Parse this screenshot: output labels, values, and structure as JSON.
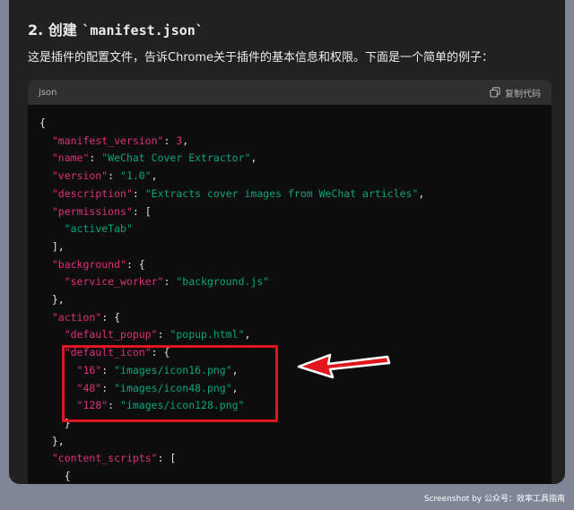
{
  "heading": {
    "prefix": "2. 创建 ",
    "code": "`manifest.json`"
  },
  "description": "这是插件的配置文件，告诉Chrome关于插件的基本信息和权限。下面是一个简单的例子：",
  "code_block": {
    "language": "json",
    "copy_label": "复制代码",
    "lines": [
      [
        [
          "p",
          "{"
        ]
      ],
      [
        [
          "p",
          "  "
        ],
        [
          "k",
          "\"manifest_version\""
        ],
        [
          "p",
          ": "
        ],
        [
          "n",
          "3"
        ],
        [
          "p",
          ","
        ]
      ],
      [
        [
          "p",
          "  "
        ],
        [
          "k",
          "\"name\""
        ],
        [
          "p",
          ": "
        ],
        [
          "s",
          "\"WeChat Cover Extractor\""
        ],
        [
          "p",
          ","
        ]
      ],
      [
        [
          "p",
          "  "
        ],
        [
          "k",
          "\"version\""
        ],
        [
          "p",
          ": "
        ],
        [
          "s",
          "\"1.0\""
        ],
        [
          "p",
          ","
        ]
      ],
      [
        [
          "p",
          "  "
        ],
        [
          "k",
          "\"description\""
        ],
        [
          "p",
          ": "
        ],
        [
          "s",
          "\"Extracts cover images from WeChat articles\""
        ],
        [
          "p",
          ","
        ]
      ],
      [
        [
          "p",
          "  "
        ],
        [
          "k",
          "\"permissions\""
        ],
        [
          "p",
          ": ["
        ]
      ],
      [
        [
          "p",
          "    "
        ],
        [
          "s",
          "\"activeTab\""
        ]
      ],
      [
        [
          "p",
          "  ],"
        ]
      ],
      [
        [
          "p",
          "  "
        ],
        [
          "k",
          "\"background\""
        ],
        [
          "p",
          ": {"
        ]
      ],
      [
        [
          "p",
          "    "
        ],
        [
          "k",
          "\"service_worker\""
        ],
        [
          "p",
          ": "
        ],
        [
          "s",
          "\"background.js\""
        ]
      ],
      [
        [
          "p",
          "  },"
        ]
      ],
      [
        [
          "p",
          "  "
        ],
        [
          "k",
          "\"action\""
        ],
        [
          "p",
          ": {"
        ]
      ],
      [
        [
          "p",
          "    "
        ],
        [
          "k",
          "\"default_popup\""
        ],
        [
          "p",
          ": "
        ],
        [
          "s",
          "\"popup.html\""
        ],
        [
          "p",
          ","
        ]
      ],
      [
        [
          "p",
          "    "
        ],
        [
          "k",
          "\"default_icon\""
        ],
        [
          "p",
          ": {"
        ]
      ],
      [
        [
          "p",
          "      "
        ],
        [
          "k",
          "\"16\""
        ],
        [
          "p",
          ": "
        ],
        [
          "s",
          "\"images/icon16.png\""
        ],
        [
          "p",
          ","
        ]
      ],
      [
        [
          "p",
          "      "
        ],
        [
          "k",
          "\"48\""
        ],
        [
          "p",
          ": "
        ],
        [
          "s",
          "\"images/icon48.png\""
        ],
        [
          "p",
          ","
        ]
      ],
      [
        [
          "p",
          "      "
        ],
        [
          "k",
          "\"128\""
        ],
        [
          "p",
          ": "
        ],
        [
          "s",
          "\"images/icon128.png\""
        ]
      ],
      [
        [
          "p",
          "    }"
        ]
      ],
      [
        [
          "p",
          "  },"
        ]
      ],
      [
        [
          "p",
          "  "
        ],
        [
          "k",
          "\"content_scripts\""
        ],
        [
          "p",
          ": ["
        ]
      ],
      [
        [
          "p",
          "    {"
        ]
      ]
    ]
  },
  "annotation": {
    "box_color": "#e0161c",
    "arrow_color": "#e0161c"
  },
  "watermark": "Screenshot by 公众号：效率工具指南",
  "colors": {
    "key": "#df3079",
    "string": "#00a67d",
    "number": "#df3079",
    "code_bg": "#0d0d0d",
    "code_header_bg": "#2f2f2f",
    "window_bg": "#212121"
  }
}
